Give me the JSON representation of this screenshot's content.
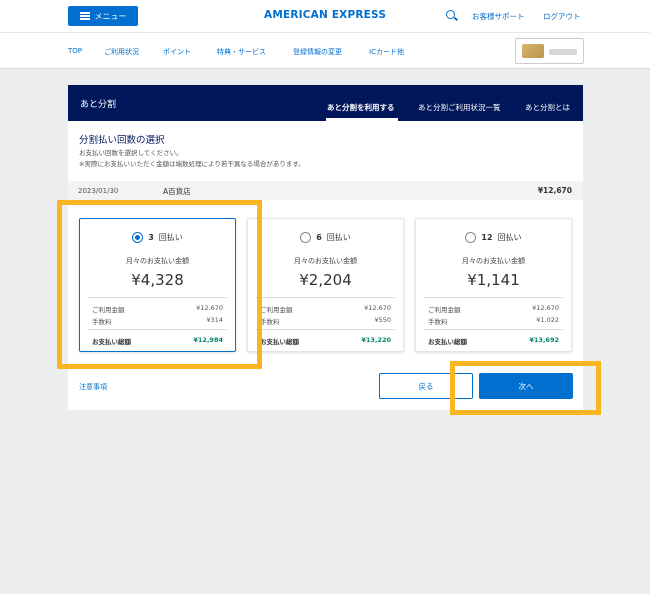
{
  "header": {
    "menu_label": "メニュー",
    "logo_text": "AMERICAN EXPRESS",
    "support_label": "お客様サポート",
    "logout_label": "ログアウト"
  },
  "nav": {
    "items": [
      "TOP",
      "ご利用状況",
      "ポイント",
      "特典・サービス",
      "登録情報の変更",
      "ICカード他"
    ]
  },
  "panel": {
    "title": "あと分割",
    "tabs": [
      "あと分割を利用する",
      "あと分割ご利用状況一覧",
      "あと分割とは"
    ],
    "active_tab_index": 0,
    "section_title": "分割払い回数の選択",
    "notes": [
      "お支払い回数を選択してください。",
      "※実際にお支払いいただく金額は端数処理により若干異なる場合があります。"
    ],
    "transaction": {
      "date": "2023/01/30",
      "merchant": "A百貨店",
      "amount": "¥12,670"
    },
    "options": [
      {
        "count": "3",
        "unit": "回払い",
        "selected": true,
        "monthly_label": "月々のお支払い金額",
        "monthly_amount": "¥4,328",
        "usage_label": "ご利用金額",
        "usage_value": "¥12,670",
        "fee_label": "手数料",
        "fee_value": "¥314",
        "total_label": "お支払い総額",
        "total_value": "¥12,984"
      },
      {
        "count": "6",
        "unit": "回払い",
        "selected": false,
        "monthly_label": "月々のお支払い金額",
        "monthly_amount": "¥2,204",
        "usage_label": "ご利用金額",
        "usage_value": "¥12,670",
        "fee_label": "手数料",
        "fee_value": "¥550",
        "total_label": "お支払い総額",
        "total_value": "¥13,220"
      },
      {
        "count": "12",
        "unit": "回払い",
        "selected": false,
        "monthly_label": "月々のお支払い金額",
        "monthly_amount": "¥1,141",
        "usage_label": "ご利用金額",
        "usage_value": "¥12,670",
        "fee_label": "手数料",
        "fee_value": "¥1,022",
        "total_label": "お支払い総額",
        "total_value": "¥13,692"
      }
    ],
    "notice_label": "注意事項",
    "back_label": "戻る",
    "next_label": "次へ"
  },
  "colors": {
    "brand_blue": "#006fcf",
    "panel_header_navy": "#00175a",
    "total_green": "#008767",
    "highlight_orange": "#fbb520"
  }
}
